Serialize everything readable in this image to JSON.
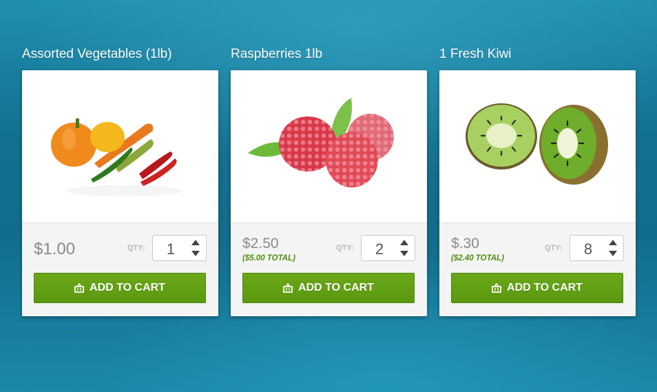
{
  "products": [
    {
      "title": "Assorted Vegetables (1lb)",
      "image_icon": "vegetables-image",
      "price": "$1.00",
      "total": "",
      "qty_label": "QTY:",
      "qty": "1",
      "button_label": "ADD TO CART"
    },
    {
      "title": "Raspberries 1lb",
      "image_icon": "raspberries-image",
      "price": "$2.50",
      "total": "($5.00 TOTAL)",
      "qty_label": "QTY:",
      "qty": "2",
      "button_label": "ADD TO CART"
    },
    {
      "title": "1 Fresh Kiwi",
      "image_icon": "kiwi-image",
      "price": "$.30",
      "total": "($2.40 TOTAL)",
      "qty_label": "QTY:",
      "qty": "8",
      "button_label": "ADD TO CART"
    }
  ],
  "colors": {
    "accent_green": "#5f9e12",
    "total_green": "#4f8f10",
    "background_blue": "#13708f"
  }
}
